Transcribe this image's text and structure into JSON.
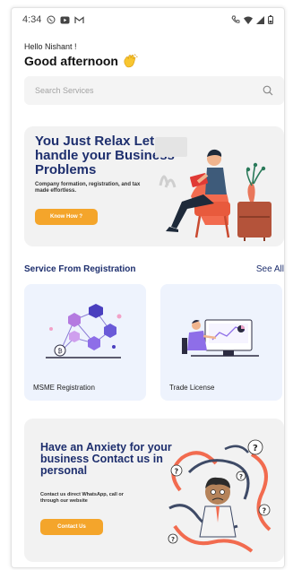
{
  "status_bar": {
    "time": "4:34",
    "icons_left": [
      "whatsapp-icon",
      "youtube-icon",
      "gmail-icon"
    ],
    "icons_right": [
      "call-icon",
      "wifi-icon",
      "signal-icon",
      "battery-icon"
    ]
  },
  "greeting": {
    "hello": "Hello Nishant !",
    "message": "Good afternoon"
  },
  "search": {
    "placeholder": "Search Services"
  },
  "banner_relax": {
    "title": "You Just Relax Let us handle your Business Problems",
    "subtitle": "Company formation, registration, and tax made effortless.",
    "button": "Know How ?"
  },
  "services": {
    "title": "Service From Registration",
    "see_all": "See All",
    "items": [
      {
        "label": "MSME Registration"
      },
      {
        "label": "Trade License"
      }
    ]
  },
  "banner_contact": {
    "title": "Have an Anxiety for your business Contact us in personal",
    "subtitle": "Contact us direct WhatsApp, call or through our website",
    "button": "Contact Us"
  },
  "colors": {
    "primary": "#1e2f6e",
    "accent": "#f4a52b",
    "card_bg": "#eef3fd",
    "banner_bg": "#f2f2f2"
  }
}
